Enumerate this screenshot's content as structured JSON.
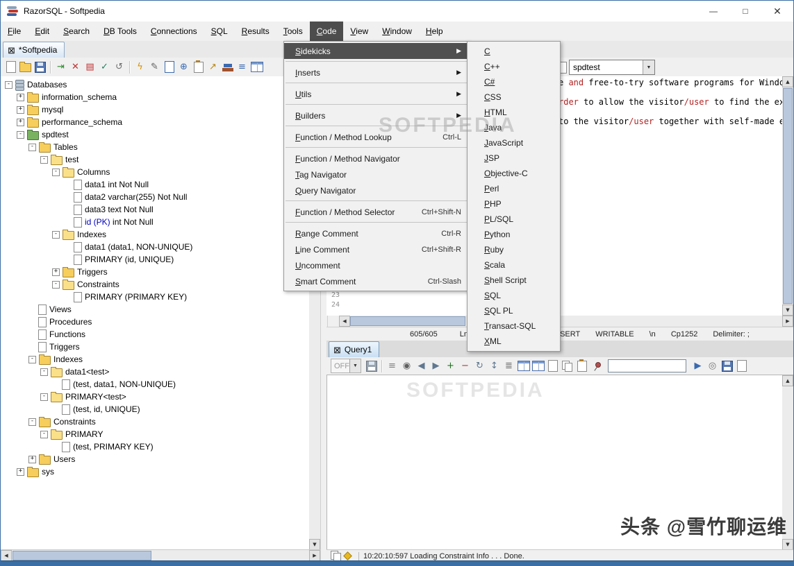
{
  "window": {
    "title": "RazorSQL - Softpedia",
    "minimize": "—",
    "maximize": "□",
    "close": "✕"
  },
  "glyphs": {
    "up": "▲",
    "down": "▼",
    "left": "◀",
    "right": "▶",
    "combo_arrow": "▼",
    "tab_close": "⊠",
    "submenu_arrow": "▶"
  },
  "menubar": {
    "items": [
      {
        "label": "File"
      },
      {
        "label": "Edit"
      },
      {
        "label": "Search"
      },
      {
        "label": "DB Tools"
      },
      {
        "label": "Connections"
      },
      {
        "label": "SQL"
      },
      {
        "label": "Results"
      },
      {
        "label": "Tools"
      },
      {
        "label": "Code",
        "active": true
      },
      {
        "label": "View"
      },
      {
        "label": "Window"
      },
      {
        "label": "Help"
      }
    ]
  },
  "document_tab": {
    "label": "*Softpedia"
  },
  "toolbar": {
    "connection_combo": {
      "value": "spdtest"
    },
    "icons": [
      {
        "name": "new-file-icon",
        "kind": "page"
      },
      {
        "name": "open-file-icon",
        "kind": "folder"
      },
      {
        "name": "save-icon",
        "kind": "floppy"
      },
      {
        "sep": true
      },
      {
        "name": "connect-icon",
        "kind": "glyph",
        "glyph": "⇥",
        "color": "#2e8b2e"
      },
      {
        "name": "disconnect-icon",
        "kind": "glyph",
        "glyph": "✕",
        "color": "#c03030"
      },
      {
        "name": "print-icon",
        "kind": "glyph",
        "glyph": "▤",
        "color": "#c03030"
      },
      {
        "name": "commit-icon",
        "kind": "glyph",
        "glyph": "✓",
        "color": "#208060"
      },
      {
        "name": "rollback-icon",
        "kind": "glyph",
        "glyph": "↺",
        "color": "#707070"
      },
      {
        "sep": true
      },
      {
        "name": "execute-sql-icon",
        "kind": "glyph",
        "glyph": "ϟ",
        "color": "#d89000"
      },
      {
        "name": "edit-sql-icon",
        "kind": "glyph",
        "glyph": "✎",
        "color": "#606060"
      },
      {
        "name": "preview-file-icon",
        "kind": "pageBlue"
      },
      {
        "name": "web-browser-icon",
        "kind": "glyph",
        "glyph": "⊕",
        "color": "#3a6ab0"
      },
      {
        "name": "clipboard-icon",
        "kind": "clip"
      },
      {
        "name": "export-icon",
        "kind": "glyph",
        "glyph": "↗",
        "color": "#b8860b"
      },
      {
        "name": "bookmarks-icon",
        "kind": "books"
      },
      {
        "name": "compare-icon",
        "kind": "glyph",
        "glyph": "≡",
        "color": "#3a6ab0"
      },
      {
        "name": "table-editor-icon",
        "kind": "table"
      }
    ]
  },
  "code_menu": {
    "items": [
      {
        "label": "Sidekicks",
        "submenu": true,
        "highlighted": true
      },
      {
        "separator": true
      },
      {
        "label": "Inserts",
        "submenu": true
      },
      {
        "separator": true
      },
      {
        "label": "Utils",
        "submenu": true
      },
      {
        "separator": true
      },
      {
        "label": "Builders",
        "submenu": true
      },
      {
        "separator": true
      },
      {
        "label": "Function / Method Lookup",
        "shortcut": "Ctrl-L"
      },
      {
        "separator": true
      },
      {
        "label": "Function / Method Navigator"
      },
      {
        "label": "Tag Navigator"
      },
      {
        "label": "Query Navigator"
      },
      {
        "separator": true
      },
      {
        "label": "Function / Method Selector",
        "shortcut": "Ctrl+Shift-N"
      },
      {
        "separator": true
      },
      {
        "label": "Range Comment",
        "shortcut": "Ctrl-R"
      },
      {
        "label": "Line Comment",
        "shortcut": "Ctrl+Shift-R"
      },
      {
        "label": "Uncomment"
      },
      {
        "label": "Smart Comment",
        "shortcut": "Ctrl-Slash"
      }
    ]
  },
  "sidekicks_submenu": {
    "items": [
      "C",
      "C++",
      "C#",
      "CSS",
      "HTML",
      "Java",
      "JavaScript",
      "JSP",
      "Objective-C",
      "Perl",
      "PHP",
      "PL/SQL",
      "Python",
      "Ruby",
      "Scala",
      "Shell Script",
      "SQL",
      "SQL PL",
      "Transact-SQL",
      "XML"
    ]
  },
  "tree": {
    "rows": [
      {
        "lv": 0,
        "tg": "-",
        "ic": "db",
        "parts": [
          [
            "Databases"
          ]
        ]
      },
      {
        "lv": 1,
        "tg": "+",
        "ic": "folder",
        "parts": [
          [
            "information_schema"
          ]
        ]
      },
      {
        "lv": 1,
        "tg": "+",
        "ic": "folder",
        "parts": [
          [
            "mysql"
          ]
        ]
      },
      {
        "lv": 1,
        "tg": "+",
        "ic": "folder",
        "parts": [
          [
            "performance_schema"
          ]
        ]
      },
      {
        "lv": 1,
        "tg": "-",
        "ic": "folderGreen",
        "parts": [
          [
            "spdtest"
          ]
        ]
      },
      {
        "lv": 2,
        "tg": "-",
        "ic": "folder",
        "parts": [
          [
            "Tables"
          ]
        ]
      },
      {
        "lv": 3,
        "tg": "-",
        "ic": "folderOpen",
        "parts": [
          [
            "test"
          ]
        ]
      },
      {
        "lv": 4,
        "tg": "-",
        "ic": "folderOpen",
        "parts": [
          [
            "Columns"
          ]
        ]
      },
      {
        "lv": 5,
        "ic": "page",
        "parts": [
          [
            "data1 int Not Null"
          ]
        ]
      },
      {
        "lv": 5,
        "ic": "page",
        "parts": [
          [
            "data2 varchar(255) Not Null"
          ]
        ]
      },
      {
        "lv": 5,
        "ic": "page",
        "parts": [
          [
            "data3 text Not Null"
          ]
        ]
      },
      {
        "lv": 5,
        "ic": "page",
        "parts": [
          [
            "id (PK)",
            "#0000bb"
          ],
          [
            " int Not Null"
          ]
        ]
      },
      {
        "lv": 4,
        "tg": "-",
        "ic": "folderOpen",
        "parts": [
          [
            "Indexes"
          ]
        ]
      },
      {
        "lv": 5,
        "ic": "page",
        "parts": [
          [
            "data1 (data1, NON-UNIQUE)"
          ]
        ]
      },
      {
        "lv": 5,
        "ic": "page",
        "parts": [
          [
            "PRIMARY (id, UNIQUE)"
          ]
        ]
      },
      {
        "lv": 4,
        "tg": "+",
        "ic": "folder",
        "parts": [
          [
            "Triggers"
          ]
        ]
      },
      {
        "lv": 4,
        "tg": "-",
        "ic": "folderOpen",
        "parts": [
          [
            "Constraints"
          ]
        ]
      },
      {
        "lv": 5,
        "ic": "page",
        "parts": [
          [
            "PRIMARY (PRIMARY KEY)"
          ]
        ]
      },
      {
        "lv": 2,
        "ic": "page",
        "parts": [
          [
            "Views"
          ]
        ]
      },
      {
        "lv": 2,
        "ic": "page",
        "parts": [
          [
            "Procedures"
          ]
        ]
      },
      {
        "lv": 2,
        "ic": "page",
        "parts": [
          [
            "Functions"
          ]
        ]
      },
      {
        "lv": 2,
        "ic": "page",
        "parts": [
          [
            "Triggers"
          ]
        ]
      },
      {
        "lv": 2,
        "tg": "-",
        "ic": "folder",
        "parts": [
          [
            "Indexes"
          ]
        ]
      },
      {
        "lv": 3,
        "tg": "-",
        "ic": "folderOpen",
        "parts": [
          [
            "data1<test>"
          ]
        ]
      },
      {
        "lv": 4,
        "ic": "page",
        "parts": [
          [
            "(test, data1, NON-UNIQUE)"
          ]
        ]
      },
      {
        "lv": 3,
        "tg": "-",
        "ic": "folderOpen",
        "parts": [
          [
            "PRIMARY<test>"
          ]
        ]
      },
      {
        "lv": 4,
        "ic": "page",
        "parts": [
          [
            "(test, id, UNIQUE)"
          ]
        ]
      },
      {
        "lv": 2,
        "tg": "-",
        "ic": "folder",
        "parts": [
          [
            "Constraints"
          ]
        ]
      },
      {
        "lv": 3,
        "tg": "-",
        "ic": "folderOpen",
        "parts": [
          [
            "PRIMARY"
          ]
        ]
      },
      {
        "lv": 4,
        "ic": "page",
        "parts": [
          [
            "(test, PRIMARY KEY)"
          ]
        ]
      },
      {
        "lv": 2,
        "tg": "+",
        "ic": "folder",
        "parts": [
          [
            "Users"
          ]
        ]
      },
      {
        "lv": 1,
        "tg": "+",
        "ic": "folder",
        "parts": [
          [
            "sys"
          ]
        ]
      }
    ]
  },
  "editor": {
    "line_count": 24,
    "text_lines": {
      "1": [
        [
          "e "
        ],
        [
          "and",
          "#b22222"
        ],
        [
          " free-to-try software programs for Windows"
        ]
      ],
      "3": [
        [
          "rder",
          "#b22222"
        ],
        [
          " to allow the visitor"
        ],
        [
          "/user",
          "#b22222"
        ],
        [
          " to find the exa"
        ]
      ],
      "5": [
        [
          "to the visitor"
        ],
        [
          "/user",
          "#b22222"
        ],
        [
          " together with self-made ev"
        ]
      ]
    },
    "status_cells": [
      "605/605",
      "Ln.",
      "INSERT",
      "WRITABLE",
      "\\n",
      "Cp1252",
      "Delimiter: ;"
    ]
  },
  "query_panel": {
    "tab_label": "Query1",
    "off_label": "OFF",
    "search_value": "",
    "icons": [
      {
        "name": "save-results-icon",
        "kind": "floppyGray"
      },
      {
        "sep": true
      },
      {
        "name": "filter-icon",
        "kind": "glyph",
        "glyph": "≡",
        "color": "#808080"
      },
      {
        "name": "find-icon",
        "kind": "glyph",
        "glyph": "◉",
        "color": "#606060"
      },
      {
        "name": "find-prev-icon",
        "kind": "glyph",
        "glyph": "◀",
        "color": "#607890"
      },
      {
        "name": "find-next-icon",
        "kind": "glyph",
        "glyph": "▶",
        "color": "#607890"
      },
      {
        "name": "add-row-icon",
        "kind": "glyph",
        "glyph": "+",
        "color": "#207020"
      },
      {
        "name": "delete-row-icon",
        "kind": "glyph",
        "glyph": "−",
        "color": "#b03030"
      },
      {
        "name": "refresh-icon",
        "kind": "glyph",
        "glyph": "↻",
        "color": "#607890"
      },
      {
        "name": "sort-icon",
        "kind": "glyph",
        "glyph": "↕",
        "color": "#607890"
      },
      {
        "name": "menu-icon",
        "kind": "glyph",
        "glyph": "≣",
        "color": "#707070"
      },
      {
        "name": "table-view-icon",
        "kind": "table"
      },
      {
        "name": "form-view-icon",
        "kind": "table"
      },
      {
        "name": "document-icon",
        "kind": "page"
      },
      {
        "name": "copy-icon",
        "kind": "copy"
      },
      {
        "name": "paste-icon",
        "kind": "clip"
      },
      {
        "name": "pin-icon",
        "kind": "pin"
      },
      {
        "input": true,
        "name": "query-search-input"
      },
      {
        "name": "run-query-icon",
        "kind": "glyph",
        "glyph": "▶",
        "color": "#3a6ab0"
      },
      {
        "name": "target-icon",
        "kind": "glyph",
        "glyph": "◎",
        "color": "#707070"
      },
      {
        "name": "save-query-icon",
        "kind": "floppy"
      },
      {
        "name": "log-icon",
        "kind": "page"
      }
    ]
  },
  "status_bar": {
    "message": "10:20:10:597 Loading Constraint Info . . . Done."
  },
  "watermarks": {
    "softpedia": "SOFTPEDIA",
    "toutiao": "头条 @雪竹聊运维"
  }
}
